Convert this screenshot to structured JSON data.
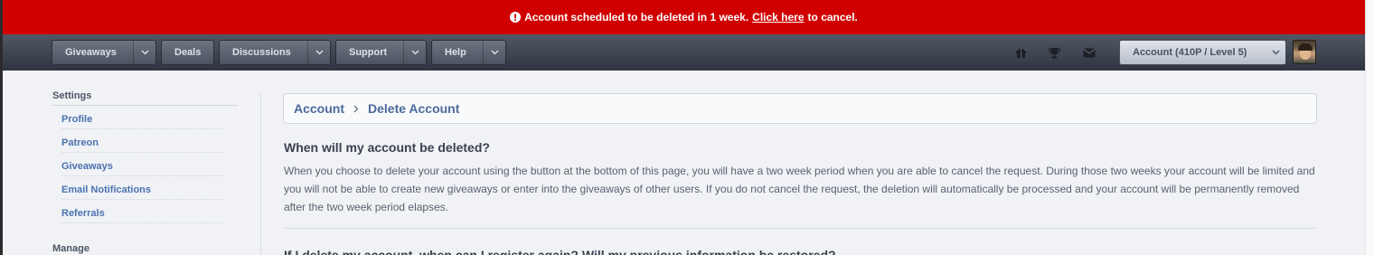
{
  "alert": {
    "message_before": "Account scheduled to be deleted in 1 week.",
    "link_text": "Click here",
    "message_after": "to cancel.",
    "icon": "exclamation-circle-icon"
  },
  "nav": {
    "giveaways": "Giveaways",
    "deals": "Deals",
    "discussions": "Discussions",
    "support": "Support",
    "help": "Help",
    "account": "Account (410P / Level 5)",
    "icons": [
      "gift-icon",
      "trophy-icon",
      "envelope-icon"
    ]
  },
  "sidebar": {
    "settings_heading": "Settings",
    "items": [
      {
        "label": "Profile"
      },
      {
        "label": "Patreon"
      },
      {
        "label": "Giveaways"
      },
      {
        "label": "Email Notifications"
      },
      {
        "label": "Referrals"
      }
    ],
    "manage_heading": "Manage"
  },
  "breadcrumb": {
    "root": "Account",
    "current": "Delete Account"
  },
  "main": {
    "q1": "When will my account be deleted?",
    "a1": "When you choose to delete your account using the button at the bottom of this page, you will have a two week period when you are able to cancel the request. During those two weeks your account will be limited and you will not be able to create new giveaways or enter into the giveaways of other users. If you do not cancel the request, the deletion will automatically be processed and your account will be permanently removed after the two week period elapses.",
    "q2": "If I delete my account, when can I register again? Will my previous information be restored?"
  },
  "colors": {
    "alert_bg": "#d10000",
    "nav_bg": "#3c424e",
    "link": "#4b72b0",
    "page_bg": "#f0f2f5"
  }
}
